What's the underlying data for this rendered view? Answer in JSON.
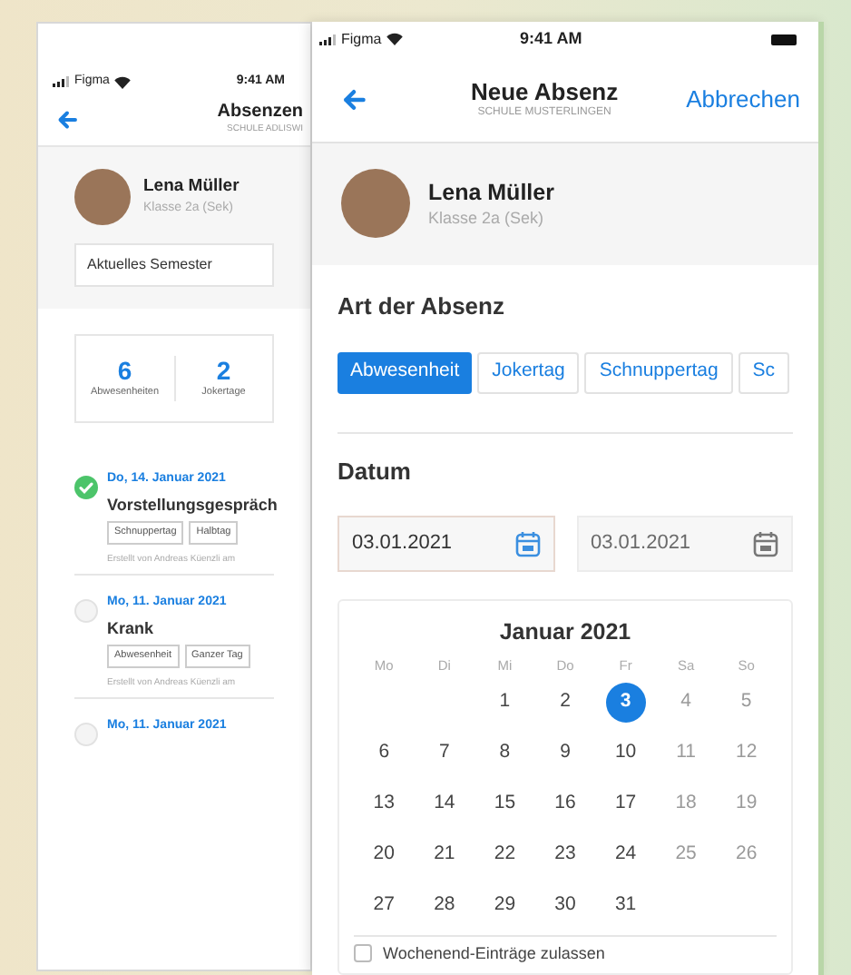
{
  "back_screen": {
    "status_bar": {
      "carrier": "Figma",
      "time": "9:41 AM"
    },
    "header": {
      "title": "Absenzen",
      "subtitle": "SCHULE ADLISWI"
    },
    "profile": {
      "name": "Lena Müller",
      "class": "Klasse 2a (Sek)"
    },
    "semester_select": {
      "value": "Aktuelles Semester"
    },
    "stats": [
      {
        "value": "6",
        "label": "Abwesenheiten"
      },
      {
        "value": "2",
        "label": "Jokertage"
      }
    ],
    "entries": [
      {
        "date": "Do, 14. Januar 2021",
        "title": "Vorstellungsgespräch",
        "tags": [
          "Schnuppertag",
          "Halbtag"
        ],
        "meta": "Erstellt von Andreas Küenzli am",
        "checked": true
      },
      {
        "date": "Mo, 11. Januar 2021",
        "title": "Krank",
        "tags": [
          "Abwesenheit",
          "Ganzer Tag"
        ],
        "meta": "Erstellt von Andreas Küenzli am",
        "checked": false
      },
      {
        "date": "Mo, 11. Januar 2021",
        "checked": false
      }
    ]
  },
  "front_screen": {
    "status_bar": {
      "carrier": "Figma",
      "time": "9:41 AM"
    },
    "header": {
      "title": "Neue Absenz",
      "subtitle": "SCHULE MUSTERLINGEN",
      "action": "Abbrechen"
    },
    "profile": {
      "name": "Lena Müller",
      "class": "Klasse 2a (Sek)"
    },
    "absence_type": {
      "label": "Art der Absenz",
      "options": [
        {
          "label": "Abwesenheit",
          "selected": true
        },
        {
          "label": "Jokertag",
          "selected": false
        },
        {
          "label": "Schnuppertag",
          "selected": false
        },
        {
          "label": "Sc",
          "selected": false
        }
      ]
    },
    "date": {
      "label": "Datum",
      "from": {
        "value": "03.01.2021",
        "active": true
      },
      "to": {
        "value": "03.01.2021",
        "active": false
      }
    },
    "calendar": {
      "title": "Januar 2021",
      "weekdays": [
        "Mo",
        "Di",
        "Mi",
        "Do",
        "Fr",
        "Sa",
        "So"
      ],
      "weeks": [
        [
          {
            "day": "1",
            "selected": false,
            "disabled": false
          },
          {
            "day": "2",
            "selected": false,
            "disabled": false
          },
          {
            "day": "3",
            "selected": true,
            "disabled": false
          },
          {
            "day": "4",
            "selected": false,
            "disabled": true
          },
          {
            "day": "5",
            "selected": false,
            "disabled": true
          }
        ],
        [
          {
            "day": "6",
            "selected": false,
            "disabled": false
          },
          {
            "day": "7",
            "selected": false,
            "disabled": false
          },
          {
            "day": "8",
            "selected": false,
            "disabled": false
          },
          {
            "day": "9",
            "selected": false,
            "disabled": false
          },
          {
            "day": "10",
            "selected": false,
            "disabled": false
          },
          {
            "day": "11",
            "selected": false,
            "disabled": true
          },
          {
            "day": "12",
            "selected": false,
            "disabled": true
          }
        ],
        [
          {
            "day": "13",
            "selected": false,
            "disabled": false
          },
          {
            "day": "14",
            "selected": false,
            "disabled": false
          },
          {
            "day": "15",
            "selected": false,
            "disabled": false
          },
          {
            "day": "16",
            "selected": false,
            "disabled": false
          },
          {
            "day": "17",
            "selected": false,
            "disabled": false
          },
          {
            "day": "18",
            "selected": false,
            "disabled": true
          },
          {
            "day": "19",
            "selected": false,
            "disabled": true
          }
        ],
        [
          {
            "day": "20",
            "selected": false,
            "disabled": false
          },
          {
            "day": "21",
            "selected": false,
            "disabled": false
          },
          {
            "day": "22",
            "selected": false,
            "disabled": false
          },
          {
            "day": "23",
            "selected": false,
            "disabled": false
          },
          {
            "day": "24",
            "selected": false,
            "disabled": false
          },
          {
            "day": "25",
            "selected": false,
            "disabled": true
          },
          {
            "day": "26",
            "selected": false,
            "disabled": true
          }
        ],
        [
          {
            "day": "27",
            "selected": false,
            "disabled": false
          },
          {
            "day": "28",
            "selected": false,
            "disabled": false
          },
          {
            "day": "29",
            "selected": false,
            "disabled": false
          },
          {
            "day": "30",
            "selected": false,
            "disabled": false
          },
          {
            "day": "31",
            "selected": false,
            "disabled": false
          }
        ]
      ],
      "weekend_option": {
        "label": "Wochenend-Einträge zulassen",
        "checked": false
      }
    }
  }
}
